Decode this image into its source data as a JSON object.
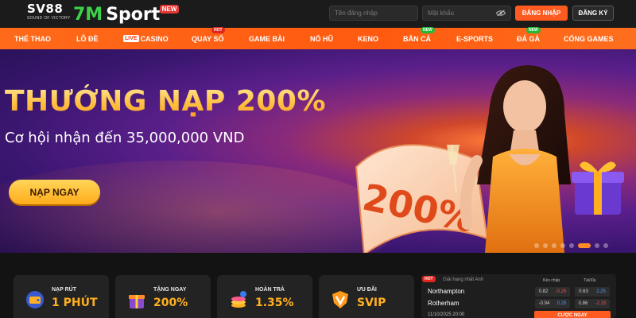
{
  "header": {
    "brand_sv": "SV88",
    "brand_sv_tagline": "SOUND OF VICTORY",
    "brand_7m_number": "7M",
    "brand_7m_word": "Sport",
    "brand_7m_badge": "NEW",
    "username_placeholder": "Tên đăng nhập",
    "password_placeholder": "Mật khẩu",
    "login_label": "ĐĂNG NHẬP",
    "register_label": "ĐĂNG KÝ"
  },
  "nav": {
    "items": [
      {
        "label": "THỂ THAO"
      },
      {
        "label": "LÔ ĐỀ"
      },
      {
        "label": "CASINO",
        "live": "LIVE"
      },
      {
        "label": "QUAY SỐ",
        "badge": "HOT"
      },
      {
        "label": "GAME BÀI"
      },
      {
        "label": "NỔ HŨ"
      },
      {
        "label": "KENO"
      },
      {
        "label": "BẮN CÁ",
        "badge": "NEW"
      },
      {
        "label": "E-SPORTS"
      },
      {
        "label": "ĐÁ GÀ",
        "badge": "NEW"
      },
      {
        "label": "CỔNG GAMES"
      }
    ]
  },
  "banner": {
    "headline": "THƯỞNG NẠP 200%",
    "subline": "Cơ hội nhận đến 35,000,000 VND",
    "cta_label": "NẠP NGAY",
    "ribbon_text": "200%",
    "slide_count": 8,
    "active_slide": 6
  },
  "features": [
    {
      "label": "NẠP RÚT",
      "value": "1 PHÚT",
      "icon": "wallet-icon"
    },
    {
      "label": "TẶNG NGAY",
      "value": "200%",
      "icon": "gift-icon"
    },
    {
      "label": "HOÀN TRẢ",
      "value": "1.35%",
      "icon": "coin-stack-icon"
    },
    {
      "label": "ƯU ĐÃI",
      "value": "SVIP",
      "icon": "vip-shield-icon"
    }
  ],
  "match": {
    "badge": "HOT",
    "league": "Giải hạng nhất Anh",
    "col_handicap": "Kèo chấp",
    "col_over_under": "Tài/Xỉu",
    "home": "Northampton",
    "away": "Rotherham",
    "time": "11/10/2025 20:00",
    "home_hcap": [
      "0.82",
      "-0.25"
    ],
    "home_ou": [
      "0.63",
      "2.25"
    ],
    "away_hcap": [
      "-0.94",
      "0.25"
    ],
    "away_ou": [
      "0.86",
      "-2.25"
    ],
    "bet_label": "CƯỢC NGAY"
  },
  "colors": {
    "accent_orange": "#ff5a1f",
    "gold": "#ffb020",
    "header_bg": "#1b1b1b"
  }
}
